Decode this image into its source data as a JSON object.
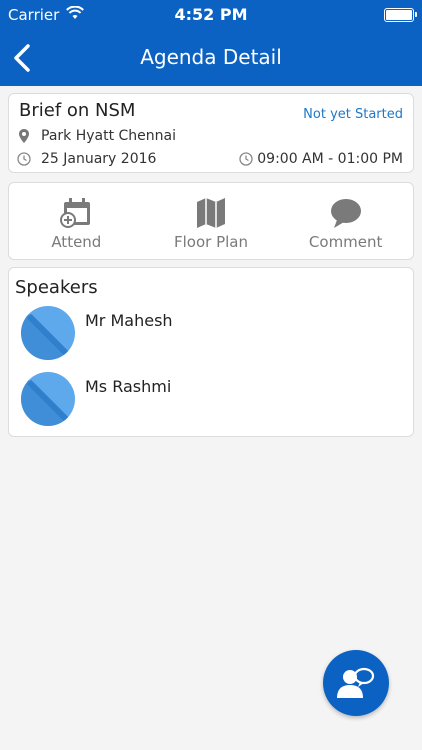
{
  "status_bar": {
    "carrier": "Carrier",
    "time": "4:52 PM",
    "icons": [
      "wifi-icon",
      "battery-icon"
    ]
  },
  "nav": {
    "title": "Agenda Detail",
    "back_icon": "chevron-left-icon"
  },
  "session": {
    "title": "Brief on NSM",
    "status": "Not yet Started",
    "venue": "Park Hyatt Chennai",
    "date": "25 January 2016",
    "time_range": "09:00 AM - 01:00 PM"
  },
  "actions": [
    {
      "label": "Attend",
      "icon": "calendar-add-icon"
    },
    {
      "label": "Floor Plan",
      "icon": "map-icon"
    },
    {
      "label": "Comment",
      "icon": "chat-bubble-icon"
    }
  ],
  "speakers": {
    "heading": "Speakers",
    "items": [
      {
        "name": "Mr Mahesh"
      },
      {
        "name": "Ms Rashmi"
      }
    ]
  },
  "colors": {
    "primary": "#0b62c2",
    "status_link": "#1f78c8",
    "icon_gray": "#7a7a7a",
    "avatar_light": "#5ea8ec",
    "avatar_dark": "#2f7fcd"
  },
  "fab": {
    "icon": "contact-chat-icon"
  }
}
